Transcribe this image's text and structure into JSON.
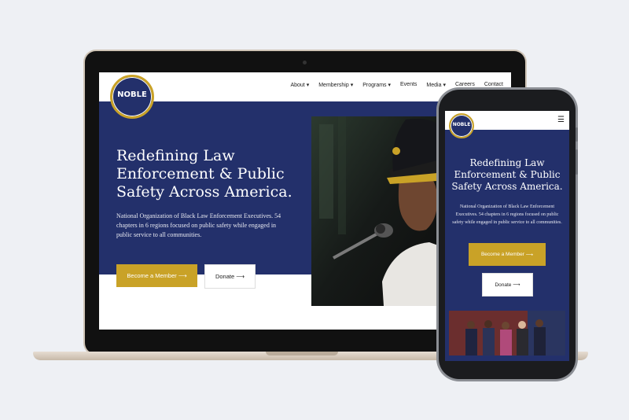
{
  "site": {
    "logo_text": "NOBLE",
    "nav": [
      "About",
      "Membership",
      "Programs",
      "Events",
      "Media",
      "Careers",
      "Contact"
    ],
    "nav_dropdowns": [
      true,
      true,
      true,
      false,
      true,
      false,
      false
    ],
    "hero_title": "Redefining Law Enforcement & Public Safety Across America.",
    "hero_text": "National Organization of Black Law Enforcement Executives. 54 chapters in 6 regions focused on public safety while engaged in public service to all communities.",
    "cta_primary": "Become a Member",
    "cta_secondary": "Donate",
    "arrow": "⟶"
  },
  "mobile": {
    "menu_icon": "hamburger-icon"
  },
  "colors": {
    "navy": "#23306b",
    "gold": "#c9a227",
    "page_bg": "#eef0f4"
  }
}
